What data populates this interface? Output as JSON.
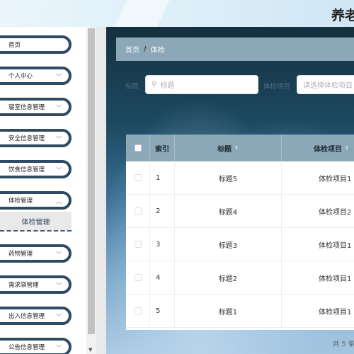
{
  "header": {
    "title": "养老"
  },
  "sidebar": {
    "items": [
      {
        "label": "首页"
      },
      {
        "label": "个人中心"
      },
      {
        "label": "寝室信息管理"
      },
      {
        "label": "安全信息管理"
      },
      {
        "label": "饮食信息管理"
      },
      {
        "label": "体检管理"
      },
      {
        "label": "药物管理"
      },
      {
        "label": "需求袋管理"
      },
      {
        "label": "出入信息管理"
      },
      {
        "label": "公告信息管理"
      }
    ],
    "active_sub": "体检管理"
  },
  "breadcrumb": {
    "home": "首页",
    "current": "体检"
  },
  "filters": {
    "label1": "标题",
    "title_placeholder": "标题",
    "label2": "体检项目",
    "project_placeholder": "请选择体检项目"
  },
  "table": {
    "columns": [
      "索引",
      "标题",
      "体检项目"
    ],
    "rows": [
      {
        "index": "1",
        "title": "标题5",
        "project": "体检项目1"
      },
      {
        "index": "2",
        "title": "标题4",
        "project": "体检项目2"
      },
      {
        "index": "3",
        "title": "标题3",
        "project": "体检项目1"
      },
      {
        "index": "4",
        "title": "标题2",
        "project": "体检项目1"
      },
      {
        "index": "5",
        "title": "标题1",
        "project": "体检项目1"
      }
    ]
  },
  "pagination": {
    "total_text": "共 5 条"
  },
  "colors": {
    "sidebar_border": "#2f4a63",
    "header_bar": "#8ca7b8",
    "chevron": "#a05ac2"
  }
}
